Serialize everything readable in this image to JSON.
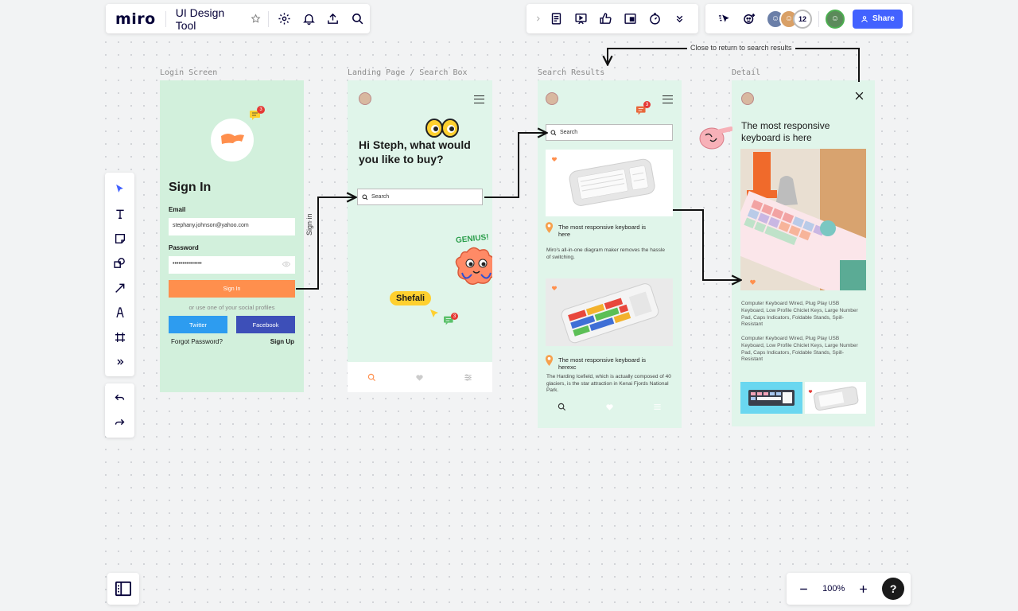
{
  "app": {
    "logo": "miro",
    "board_title": "UI Design Tool"
  },
  "collab": {
    "avatar_count": "12",
    "share_label": "Share"
  },
  "zoom": {
    "level": "100%",
    "help": "?"
  },
  "frames": {
    "login_label": "Login Screen",
    "landing_label": "Landing Page / Search Box",
    "results_label": "Search Results",
    "detail_label": "Detail"
  },
  "login": {
    "title": "Sign In",
    "email_label": "Email",
    "email_value": "stephany.johnson@yahoo.com",
    "password_label": "Password",
    "password_value": "•••••••••••••••",
    "signin_button": "Sign In",
    "social_text": "or use one of your social profiles",
    "twitter": "Twitter",
    "facebook": "Facebook",
    "forgot": "Forgot Password?",
    "signup": "Sign Up",
    "notif_count": "3"
  },
  "landing": {
    "greeting": "Hi Steph, what would you like to buy?",
    "search_placeholder": "Search",
    "sticker_name": "Shefali",
    "genius": "GENIUS!",
    "notif_count": "3"
  },
  "results": {
    "search_placeholder": "Search",
    "notif_count": "3",
    "card1_title": "The most responsive keyboard is here",
    "card1_desc": "Miro's all-in-one diagram maker removes the hassle of switching.",
    "card2_title": "The most responsive keyboard is herexc",
    "card2_desc": "The Harding Icefield, which is actually composed of 40 glaciers, is the star attraction in Kenai Fjords National Park."
  },
  "detail": {
    "title": "The most responsive keyboard is here",
    "desc1": "Computer Keyboard Wired, Plug Play USB Keyboard, Low Profile Chiclet Keys, Large Number Pad, Caps Indicators, Foldable Stands, Spill-Resistant",
    "desc2": "Computer Keyboard Wired, Plug Play USB Keyboard, Low Profile Chiclet Keys, Large Number Pad, Caps Indicators, Foldable Stands, Spill-Resistant"
  },
  "connectors": {
    "signin_label": "Sign in",
    "close_label": "Close to return to search results"
  },
  "colors": {
    "accent": "#4262ff",
    "frame_green": "#d2f0dc",
    "orange": "#ff8f4d"
  }
}
